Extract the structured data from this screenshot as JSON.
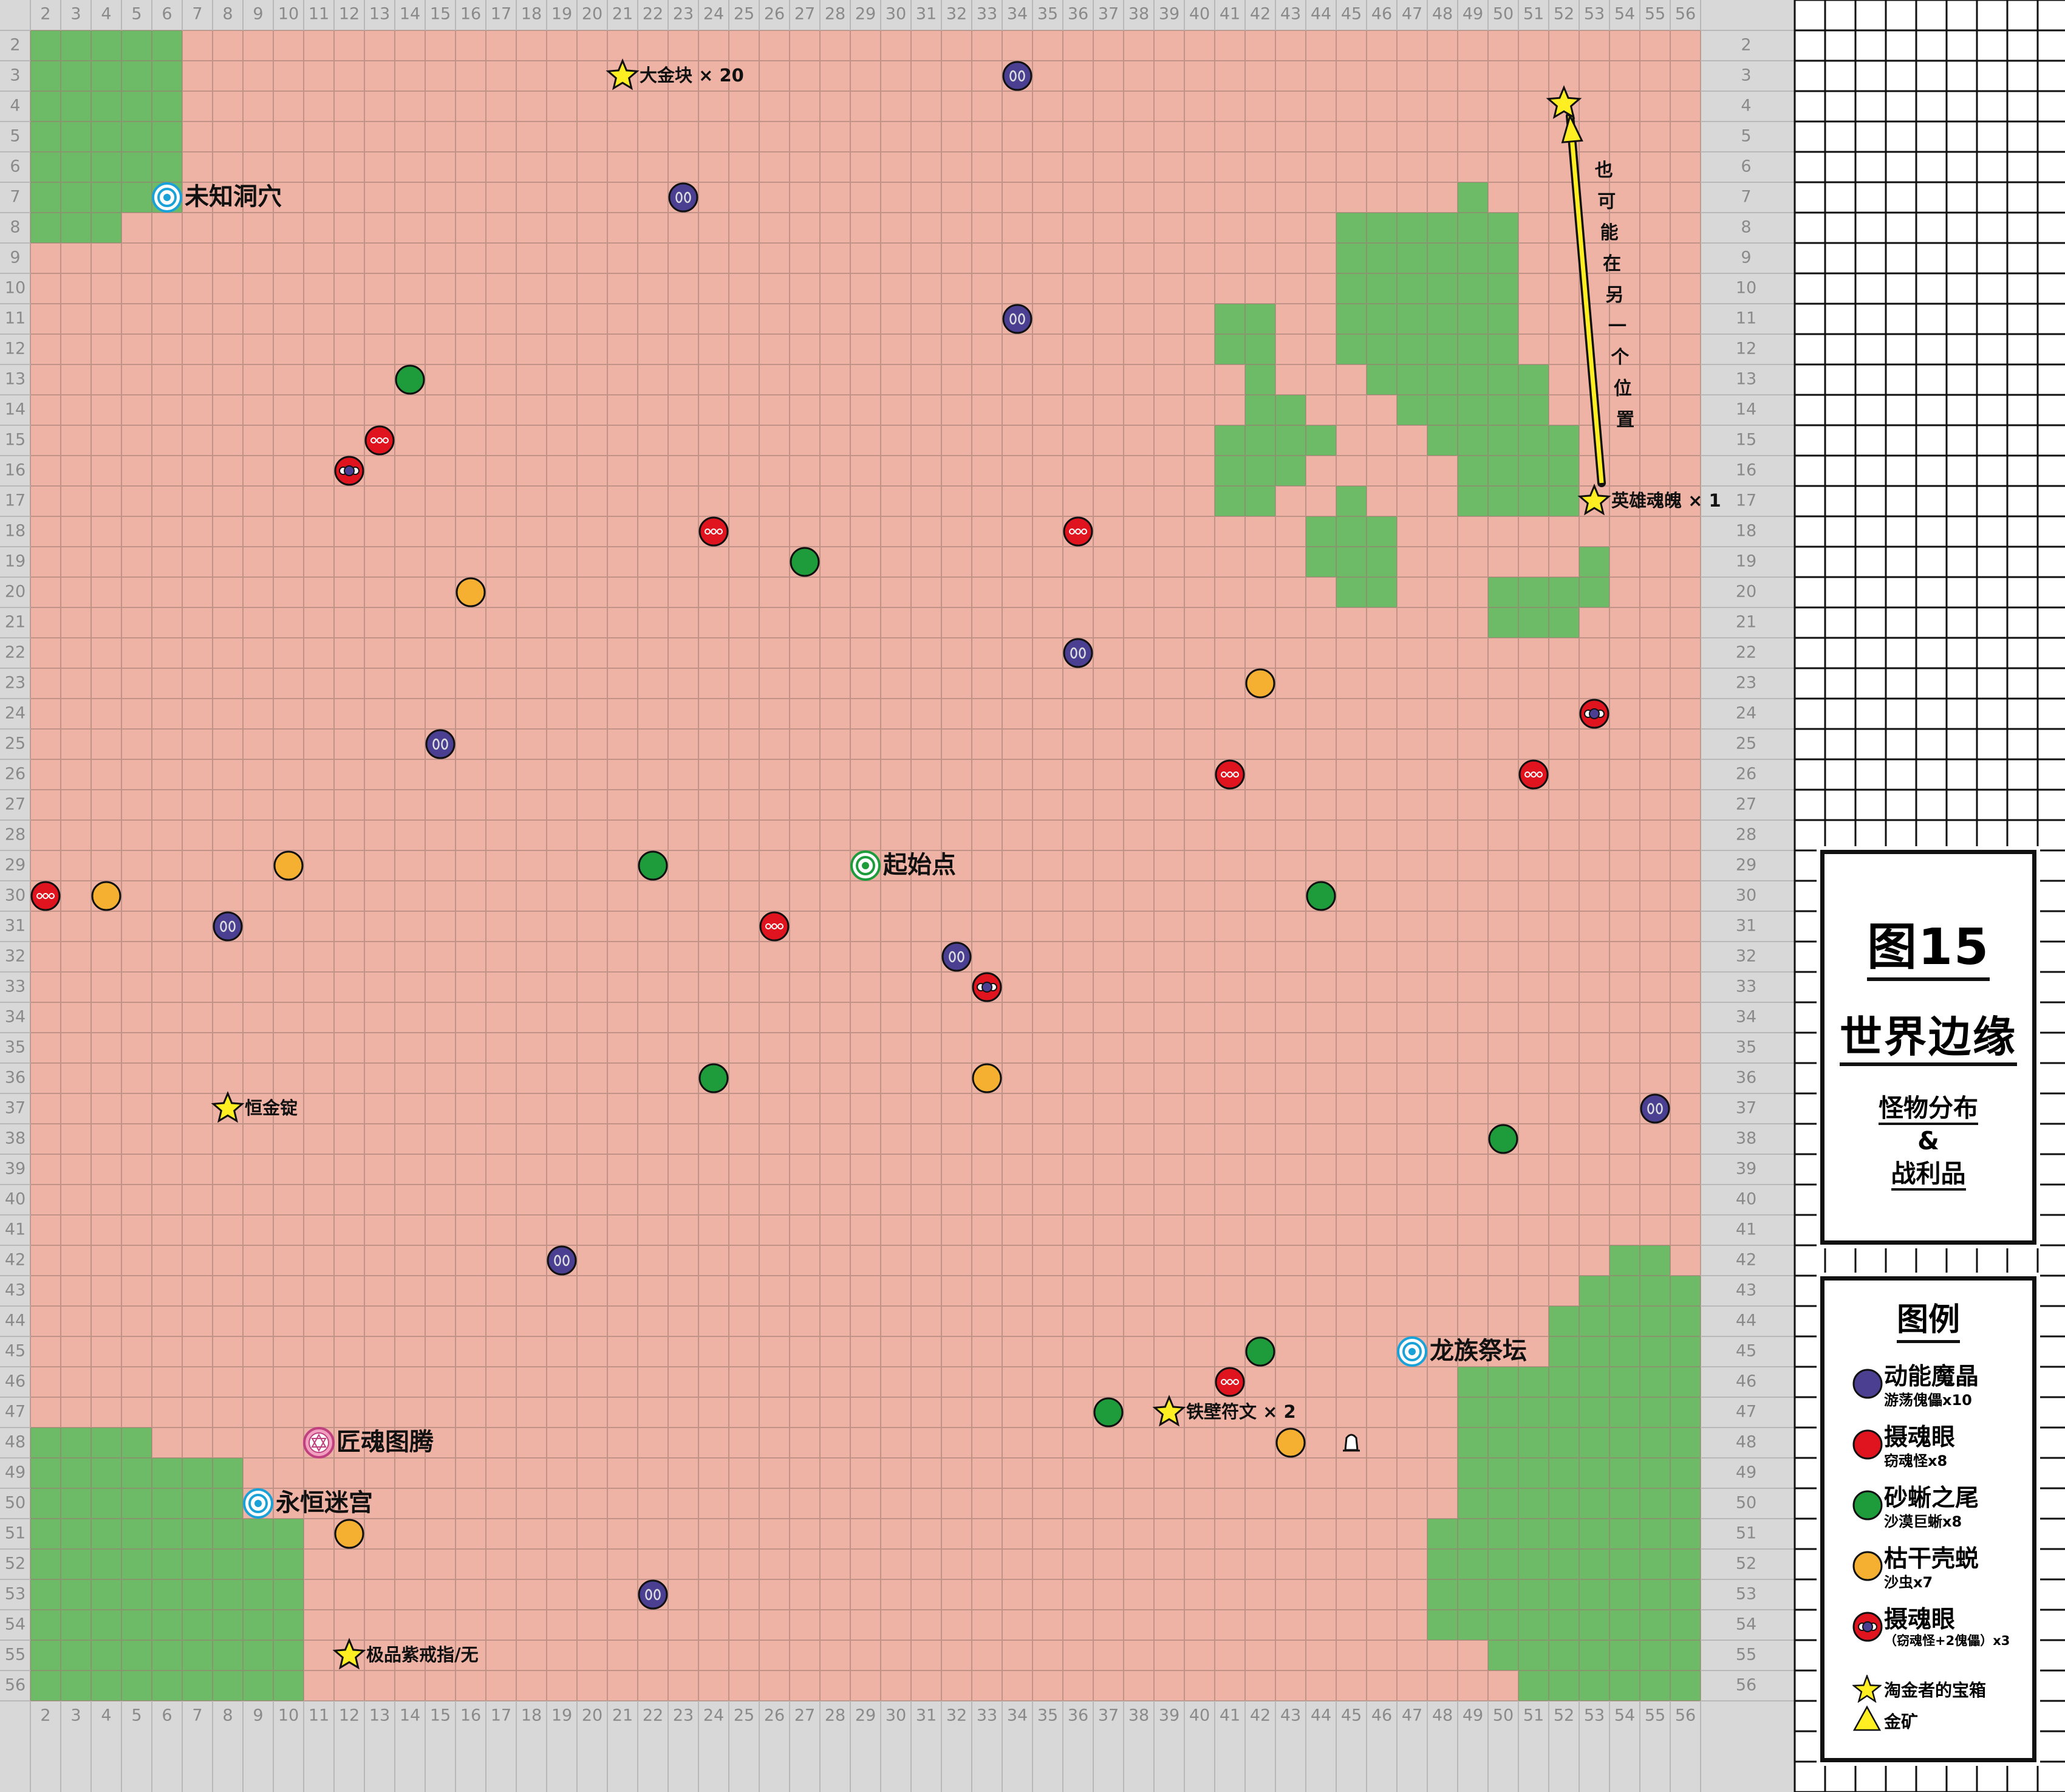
{
  "map": {
    "columns": [
      2,
      3,
      4,
      5,
      6,
      7,
      8,
      9,
      10,
      11,
      12,
      13,
      14,
      15,
      16,
      17,
      18,
      19,
      20,
      21,
      22,
      23,
      24,
      25,
      26,
      27,
      28,
      29,
      30,
      31,
      32,
      33,
      34,
      35,
      36,
      37,
      38,
      39,
      40,
      41,
      42,
      43,
      44,
      45,
      46,
      47,
      48,
      49,
      50,
      51,
      52,
      53,
      54,
      55,
      56
    ],
    "rows": [
      2,
      3,
      4,
      5,
      6,
      7,
      8,
      9,
      10,
      11,
      12,
      13,
      14,
      15,
      16,
      17,
      18,
      19,
      20,
      21,
      22,
      23,
      24,
      25,
      26,
      27,
      28,
      29,
      30,
      31,
      32,
      33,
      34,
      35,
      36,
      37,
      38,
      39,
      40,
      41,
      42,
      43,
      44,
      45,
      46,
      47,
      48,
      49,
      50,
      51,
      52,
      53,
      54,
      55,
      56
    ],
    "colors": {
      "sand": "#efb3a5",
      "grass": "#6dbb67",
      "frame": "#d8d8d8",
      "grid_line": "#9c7a72",
      "crystal": "#4b3f92",
      "eye": "#e0141e",
      "tail": "#1e9c3c",
      "husk": "#f5b032",
      "star": "#ffee22"
    },
    "grass_blocks": [
      {
        "c1": 2,
        "c2": 6,
        "r1": 2,
        "r2": 7
      },
      {
        "c1": 2,
        "c2": 4,
        "r1": 8,
        "r2": 8
      },
      {
        "c1": 49,
        "c2": 49,
        "r1": 7,
        "r2": 7
      },
      {
        "c1": 45,
        "c2": 50,
        "r1": 8,
        "r2": 12
      },
      {
        "c1": 41,
        "c2": 42,
        "r1": 11,
        "r2": 12
      },
      {
        "c1": 46,
        "c2": 51,
        "r1": 13,
        "r2": 13
      },
      {
        "c1": 47,
        "c2": 51,
        "r1": 14,
        "r2": 14
      },
      {
        "c1": 48,
        "c2": 52,
        "r1": 15,
        "r2": 15
      },
      {
        "c1": 49,
        "c2": 52,
        "r1": 16,
        "r2": 17
      },
      {
        "c1": 42,
        "c2": 42,
        "r1": 13,
        "r2": 13
      },
      {
        "c1": 42,
        "c2": 43,
        "r1": 14,
        "r2": 14
      },
      {
        "c1": 41,
        "c2": 44,
        "r1": 15,
        "r2": 15
      },
      {
        "c1": 41,
        "c2": 43,
        "r1": 16,
        "r2": 16
      },
      {
        "c1": 41,
        "c2": 42,
        "r1": 17,
        "r2": 17
      },
      {
        "c1": 45,
        "c2": 45,
        "r1": 17,
        "r2": 17
      },
      {
        "c1": 44,
        "c2": 46,
        "r1": 18,
        "r2": 19
      },
      {
        "c1": 45,
        "c2": 46,
        "r1": 20,
        "r2": 20
      },
      {
        "c1": 53,
        "c2": 53,
        "r1": 19,
        "r2": 19
      },
      {
        "c1": 50,
        "c2": 53,
        "r1": 20,
        "r2": 20
      },
      {
        "c1": 50,
        "c2": 52,
        "r1": 21,
        "r2": 21
      },
      {
        "c1": 54,
        "c2": 55,
        "r1": 42,
        "r2": 42
      },
      {
        "c1": 53,
        "c2": 56,
        "r1": 43,
        "r2": 43
      },
      {
        "c1": 52,
        "c2": 56,
        "r1": 44,
        "r2": 45
      },
      {
        "c1": 49,
        "c2": 56,
        "r1": 46,
        "r2": 50
      },
      {
        "c1": 48,
        "c2": 56,
        "r1": 51,
        "r2": 54
      },
      {
        "c1": 50,
        "c2": 56,
        "r1": 55,
        "r2": 55
      },
      {
        "c1": 51,
        "c2": 56,
        "r1": 56,
        "r2": 56
      },
      {
        "c1": 2,
        "c2": 5,
        "r1": 48,
        "r2": 48
      },
      {
        "c1": 2,
        "c2": 8,
        "r1": 49,
        "r2": 50
      },
      {
        "c1": 2,
        "c2": 10,
        "r1": 51,
        "r2": 56
      }
    ],
    "monsters": [
      {
        "type": "crystal",
        "c": 34,
        "r": 3
      },
      {
        "type": "crystal",
        "c": 23,
        "r": 7
      },
      {
        "type": "crystal",
        "c": 34,
        "r": 11
      },
      {
        "type": "crystal",
        "c": 36,
        "r": 22
      },
      {
        "type": "crystal",
        "c": 15,
        "r": 25
      },
      {
        "type": "crystal",
        "c": 8,
        "r": 31
      },
      {
        "type": "crystal",
        "c": 32,
        "r": 32
      },
      {
        "type": "crystal",
        "c": 55,
        "r": 37
      },
      {
        "type": "crystal",
        "c": 19,
        "r": 42
      },
      {
        "type": "crystal",
        "c": 22,
        "r": 53
      },
      {
        "type": "eye",
        "c": 13,
        "r": 15
      },
      {
        "type": "eye",
        "c": 24,
        "r": 18
      },
      {
        "type": "eye",
        "c": 36,
        "r": 18
      },
      {
        "type": "eye",
        "c": 41,
        "r": 26
      },
      {
        "type": "eye",
        "c": 51,
        "r": 26
      },
      {
        "type": "eye",
        "c": 2,
        "r": 30
      },
      {
        "type": "eye",
        "c": 26,
        "r": 31
      },
      {
        "type": "eye",
        "c": 41,
        "r": 46
      },
      {
        "type": "tail",
        "c": 14,
        "r": 13
      },
      {
        "type": "tail",
        "c": 27,
        "r": 19
      },
      {
        "type": "tail",
        "c": 22,
        "r": 29
      },
      {
        "type": "tail",
        "c": 44,
        "r": 30
      },
      {
        "type": "tail",
        "c": 24,
        "r": 36
      },
      {
        "type": "tail",
        "c": 50,
        "r": 38
      },
      {
        "type": "tail",
        "c": 42,
        "r": 45
      },
      {
        "type": "tail",
        "c": 37,
        "r": 47
      },
      {
        "type": "husk",
        "c": 16,
        "r": 20
      },
      {
        "type": "husk",
        "c": 42,
        "r": 23
      },
      {
        "type": "husk",
        "c": 10,
        "r": 29
      },
      {
        "type": "husk",
        "c": 4,
        "r": 30
      },
      {
        "type": "husk",
        "c": 33,
        "r": 36
      },
      {
        "type": "husk",
        "c": 43,
        "r": 48
      },
      {
        "type": "husk",
        "c": 12,
        "r": 51
      },
      {
        "type": "combo",
        "c": 12,
        "r": 16
      },
      {
        "type": "combo",
        "c": 53,
        "r": 24
      },
      {
        "type": "combo",
        "c": 33,
        "r": 33
      }
    ],
    "chests": [
      {
        "c": 21,
        "r": 3,
        "label": "大金块 × 20"
      },
      {
        "c": 53,
        "r": 17,
        "label": "英雄魂魄 × 1"
      },
      {
        "c": 8,
        "r": 37,
        "label": "恒金锭"
      },
      {
        "c": 39,
        "r": 47,
        "label": "铁壁符文 × 2"
      },
      {
        "c": 12,
        "r": 55,
        "label": "极品紫戒指/无"
      }
    ],
    "alt_chest": {
      "c": 52,
      "r": 4
    },
    "arrow_note": "也可能在另一个位置",
    "places": [
      {
        "kind": "portal",
        "c": 6,
        "r": 7,
        "label": "未知洞穴"
      },
      {
        "kind": "start",
        "c": 29,
        "r": 29,
        "label": "起始点"
      },
      {
        "kind": "portal",
        "c": 47,
        "r": 45,
        "label": "龙族祭坛"
      },
      {
        "kind": "totem",
        "c": 11,
        "r": 48,
        "label": "匠魂图腾"
      },
      {
        "kind": "portal",
        "c": 9,
        "r": 50,
        "label": "永恒迷宫"
      }
    ],
    "bell": {
      "c": 45,
      "r": 48
    }
  },
  "title_panel": {
    "figure": "图15",
    "region": "世界边缘",
    "line1": "怪物分布",
    "line2": "&",
    "line3": "战利品"
  },
  "legend": {
    "title": "图例",
    "crystal": {
      "name": "动能魔晶",
      "desc": "游荡傀儡x10"
    },
    "eye": {
      "name": "摄魂眼",
      "desc": "窃魂怪x8"
    },
    "tail": {
      "name": "砂蜥之尾",
      "desc": "沙漠巨蜥x8"
    },
    "husk": {
      "name": "枯干壳蜕",
      "desc": "沙虫x7"
    },
    "combo": {
      "name": "摄魂眼",
      "desc": "（窃魂怪+2傀儡）x3"
    },
    "chest": "淘金者的宝箱",
    "gold": "金矿"
  }
}
